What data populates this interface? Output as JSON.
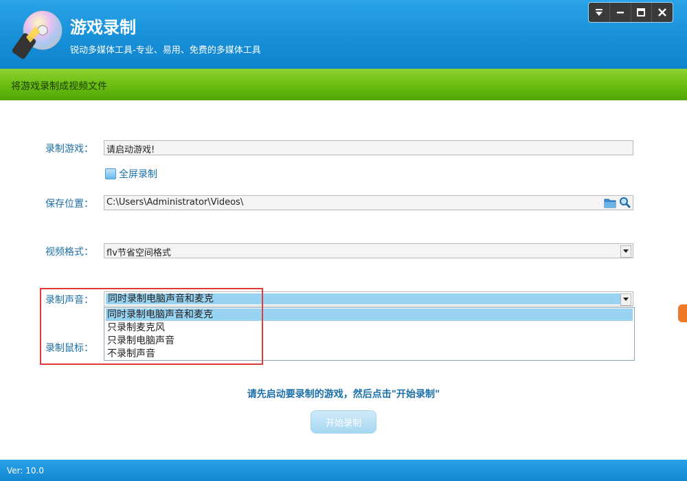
{
  "app": {
    "title": "游戏录制",
    "subtitle": "锐动多媒体工具-专业、易用、免费的多媒体工具",
    "section_title": "将游戏录制成视频文件",
    "version": "Ver: 10.0"
  },
  "window_controls": [
    "menu-icon",
    "minimize-icon",
    "maximize-icon",
    "close-icon"
  ],
  "form": {
    "game_label": "录制游戏：",
    "game_value": "请启动游戏!",
    "fullscreen_label": "全屏录制",
    "fullscreen_checked": false,
    "save_label": "保存位置：",
    "save_value": "C:\\Users\\Administrator\\Videos\\",
    "format_label": "视频格式：",
    "format_value": "flv节省空间格式",
    "audio_label": "录制声音：",
    "audio_value": "同时录制电脑声音和麦克",
    "mouse_label": "录制鼠标：",
    "audio_options": [
      "同时录制电脑声音和麦克",
      "只录制麦克风",
      "只录制电脑声音",
      "不录制声音"
    ],
    "audio_selected_index": 0
  },
  "hint": "请先启动要录制的游戏，然后点击\"开始录制\"",
  "start_button": "开始录制",
  "colors": {
    "header_blue": "#1790d8",
    "green_bar": "#6cbf12",
    "label_blue": "#1b6fa8",
    "highlight_red": "#e23a3a",
    "selection_blue": "#99d3f2"
  }
}
